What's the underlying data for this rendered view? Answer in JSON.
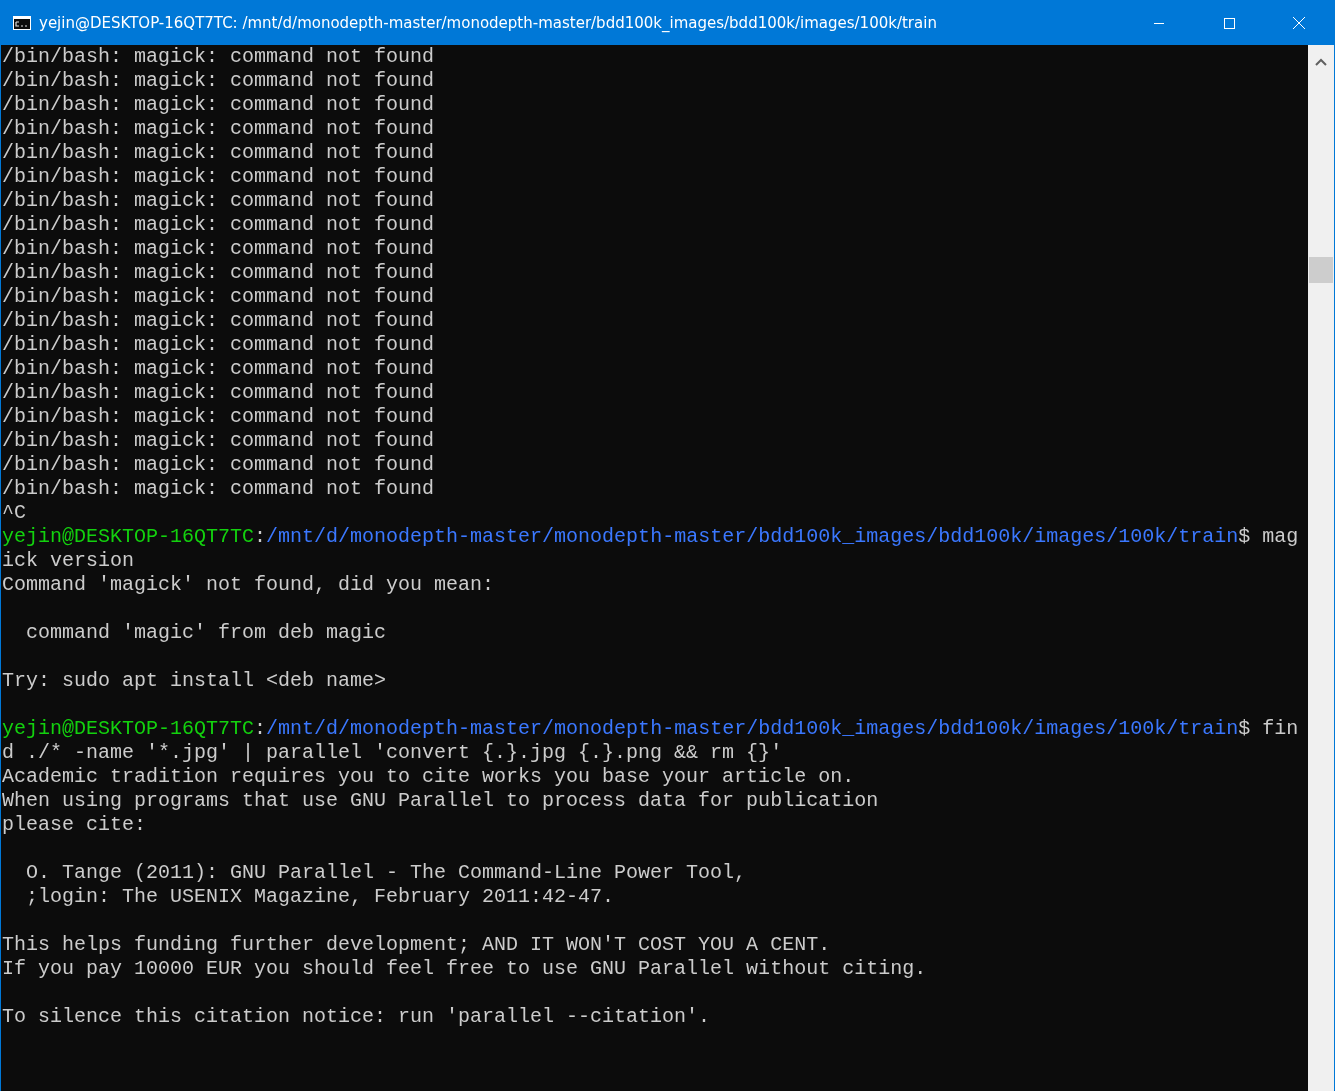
{
  "window": {
    "title": "yejin@DESKTOP-16QT7TC: /mnt/d/monodepth-master/monodepth-master/bdd100k_images/bdd100k/images/100k/train"
  },
  "console": {
    "lines": [
      {
        "kind": "output",
        "text": "/bin/bash: magick: command not found"
      },
      {
        "kind": "output",
        "text": "/bin/bash: magick: command not found"
      },
      {
        "kind": "output",
        "text": "/bin/bash: magick: command not found"
      },
      {
        "kind": "output",
        "text": "/bin/bash: magick: command not found"
      },
      {
        "kind": "output",
        "text": "/bin/bash: magick: command not found"
      },
      {
        "kind": "output",
        "text": "/bin/bash: magick: command not found"
      },
      {
        "kind": "output",
        "text": "/bin/bash: magick: command not found"
      },
      {
        "kind": "output",
        "text": "/bin/bash: magick: command not found"
      },
      {
        "kind": "output",
        "text": "/bin/bash: magick: command not found"
      },
      {
        "kind": "output",
        "text": "/bin/bash: magick: command not found"
      },
      {
        "kind": "output",
        "text": "/bin/bash: magick: command not found"
      },
      {
        "kind": "output",
        "text": "/bin/bash: magick: command not found"
      },
      {
        "kind": "output",
        "text": "/bin/bash: magick: command not found"
      },
      {
        "kind": "output",
        "text": "/bin/bash: magick: command not found"
      },
      {
        "kind": "output",
        "text": "/bin/bash: magick: command not found"
      },
      {
        "kind": "output",
        "text": "/bin/bash: magick: command not found"
      },
      {
        "kind": "output",
        "text": "/bin/bash: magick: command not found"
      },
      {
        "kind": "output",
        "text": "/bin/bash: magick: command not found"
      },
      {
        "kind": "output",
        "text": "/bin/bash: magick: command not found"
      },
      {
        "kind": "output",
        "text": "^C"
      },
      {
        "kind": "prompt",
        "user": "yejin@DESKTOP-16QT7TC",
        "separator": ":",
        "path": "/mnt/d/monodepth-master/monodepth-master/bdd100k_images/bdd100k/images/100k/train",
        "command": "$ mag"
      },
      {
        "kind": "output",
        "text": "ick version"
      },
      {
        "kind": "output",
        "text": "Command 'magick' not found, did you mean:"
      },
      {
        "kind": "blank"
      },
      {
        "kind": "output",
        "text": "  command 'magic' from deb magic"
      },
      {
        "kind": "blank"
      },
      {
        "kind": "output",
        "text": "Try: sudo apt install <deb name>"
      },
      {
        "kind": "blank"
      },
      {
        "kind": "prompt",
        "user": "yejin@DESKTOP-16QT7TC",
        "separator": ":",
        "path": "/mnt/d/monodepth-master/monodepth-master/bdd100k_images/bdd100k/images/100k/train",
        "command": "$ fin"
      },
      {
        "kind": "output",
        "text": "d ./* -name '*.jpg' | parallel 'convert {.}.jpg {.}.png && rm {}'"
      },
      {
        "kind": "output",
        "text": "Academic tradition requires you to cite works you base your article on."
      },
      {
        "kind": "output",
        "text": "When using programs that use GNU Parallel to process data for publication"
      },
      {
        "kind": "output",
        "text": "please cite:"
      },
      {
        "kind": "blank"
      },
      {
        "kind": "output",
        "text": "  O. Tange (2011): GNU Parallel - The Command-Line Power Tool,"
      },
      {
        "kind": "output",
        "text": "  ;login: The USENIX Magazine, February 2011:42-47."
      },
      {
        "kind": "blank"
      },
      {
        "kind": "output",
        "text": "This helps funding further development; AND IT WON'T COST YOU A CENT."
      },
      {
        "kind": "output",
        "text": "If you pay 10000 EUR you should feel free to use GNU Parallel without citing."
      },
      {
        "kind": "blank"
      },
      {
        "kind": "output",
        "text": "To silence this citation notice: run 'parallel --citation'."
      }
    ]
  }
}
